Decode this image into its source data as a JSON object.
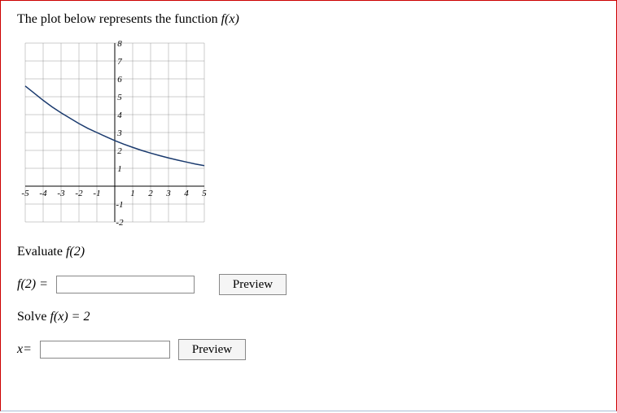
{
  "problem": {
    "intro_pre": "The plot below represents the function ",
    "intro_fn": "f(x)"
  },
  "chart_data": {
    "type": "line",
    "xlim": [
      -5,
      5
    ],
    "ylim": [
      -2,
      8
    ],
    "xticks": [
      -5,
      -4,
      -3,
      -2,
      -1,
      1,
      2,
      3,
      4,
      5
    ],
    "yticks": [
      -2,
      -1,
      1,
      2,
      3,
      4,
      5,
      6,
      7,
      8
    ],
    "series": [
      {
        "name": "f(x)",
        "x": [
          -5,
          -4.5,
          -4,
          -3.5,
          -3,
          -2.5,
          -2,
          -1.5,
          -1,
          -0.5,
          0,
          0.5,
          1,
          1.5,
          2,
          2.5,
          3,
          3.5,
          4,
          4.5,
          5
        ],
        "values": [
          5.6,
          5.2,
          4.8,
          4.43,
          4.1,
          3.8,
          3.5,
          3.23,
          3.0,
          2.77,
          2.55,
          2.35,
          2.17,
          2.0,
          1.85,
          1.71,
          1.58,
          1.46,
          1.35,
          1.24,
          1.15
        ]
      }
    ]
  },
  "questions": {
    "q1": {
      "prompt_pre": "Evaluate ",
      "prompt_fn": "f(2)",
      "label_pre": "f(2) = ",
      "value": "",
      "preview_label": "Preview"
    },
    "q2": {
      "prompt_pre": "Solve ",
      "prompt_fn": "f(x) = 2",
      "label_pre": "x= ",
      "value": "",
      "preview_label": "Preview"
    }
  }
}
